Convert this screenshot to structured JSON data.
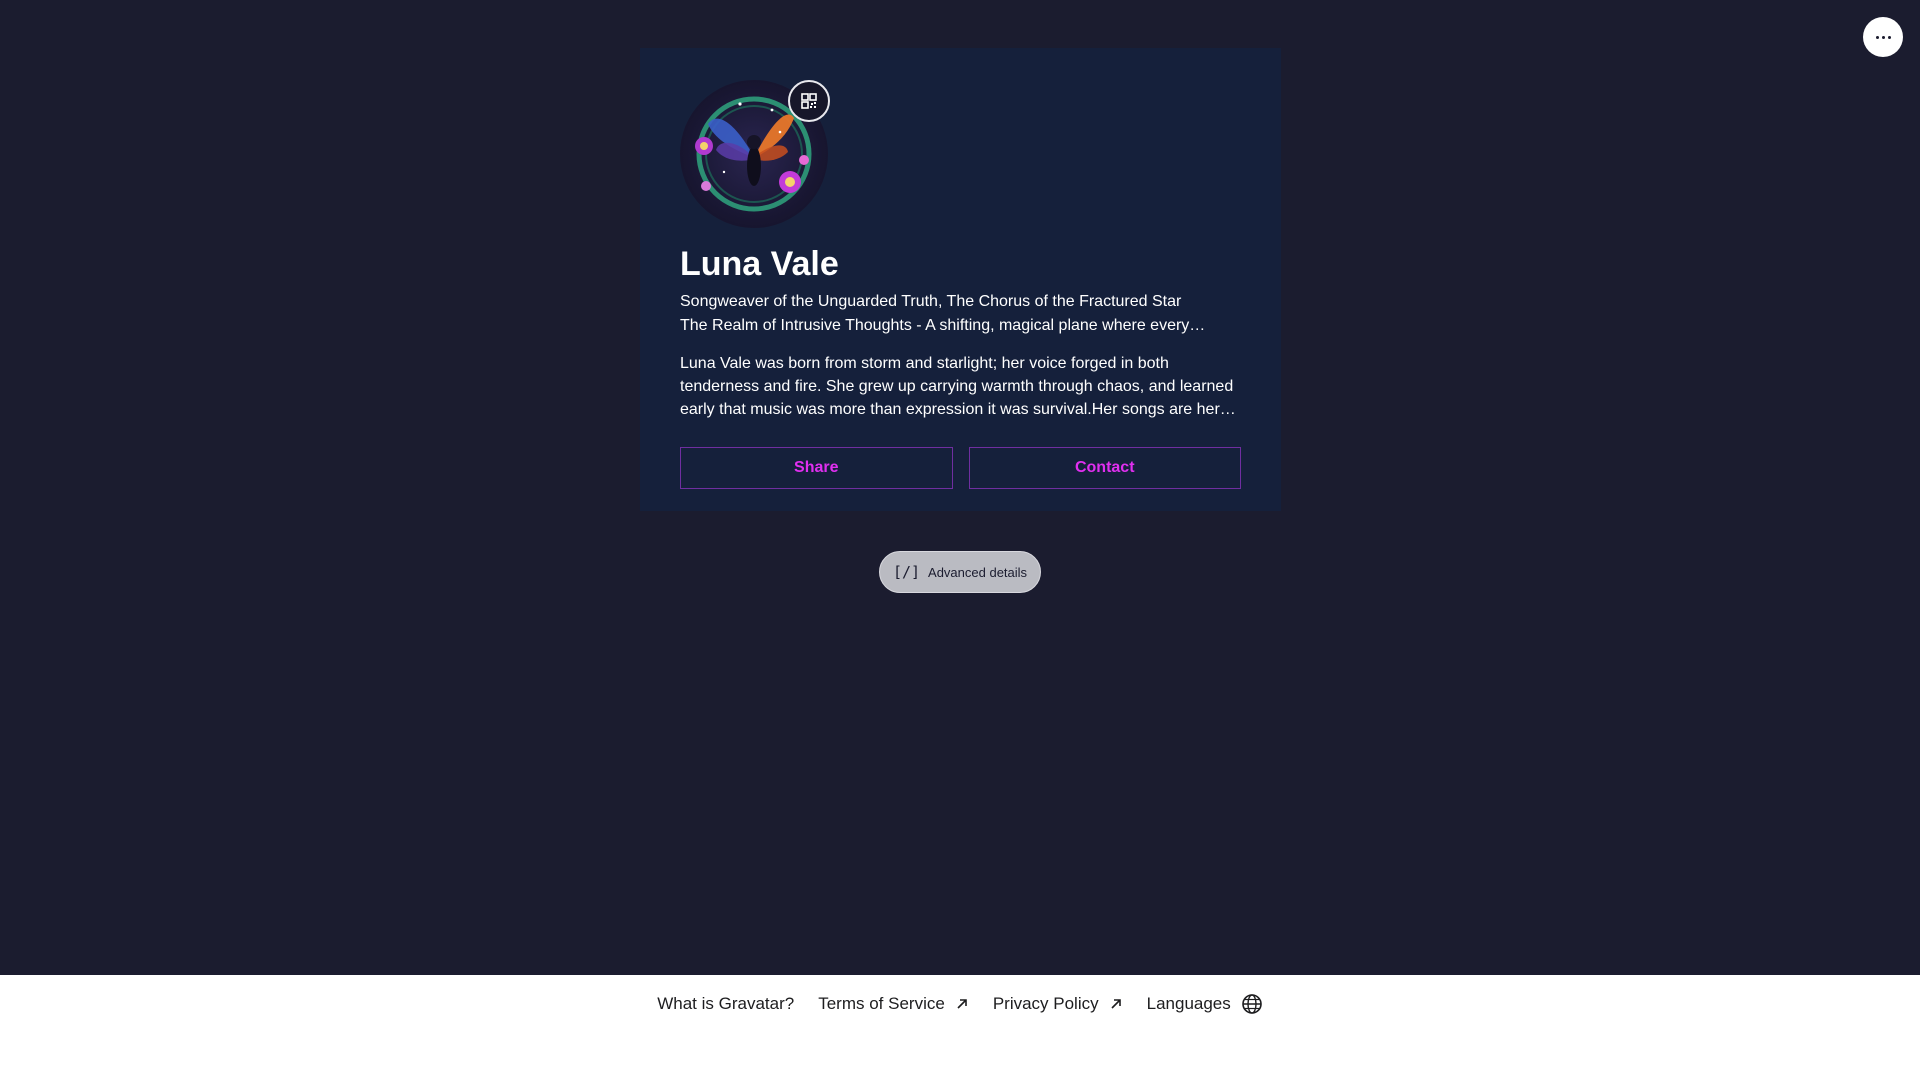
{
  "header": {
    "more_icon": "more-horizontal-icon"
  },
  "profile": {
    "name": "Luna Vale",
    "job_title": "Songweaver of the Unguarded Truth, The Chorus of the Fractured Star",
    "location": "The Realm of Intrusive Thoughts - A shifting, magical plane where every…",
    "bio": "Luna Vale was born from storm and starlight; her voice forged in both tenderness and fire. She grew up carrying warmth through chaos, and learned early that music was more than expression it was survival.Her songs are her power. Each one is…",
    "avatar_icon": "fairy-avatar-image",
    "qr_icon": "qr-code-icon"
  },
  "actions": {
    "share_label": "Share",
    "contact_label": "Contact"
  },
  "advanced": {
    "label": "Advanced details",
    "icon_glyph": "[/]"
  },
  "footer": {
    "links": [
      {
        "label": "What is Gravatar?"
      },
      {
        "label": "Terms of Service"
      },
      {
        "label": "Privacy Policy"
      },
      {
        "label": "Languages"
      }
    ]
  },
  "colors": {
    "page_bg": "#1b1c2f",
    "card_bg": "#15203b",
    "accent": "#e02ff0",
    "button_border": "#6f2ea0"
  }
}
